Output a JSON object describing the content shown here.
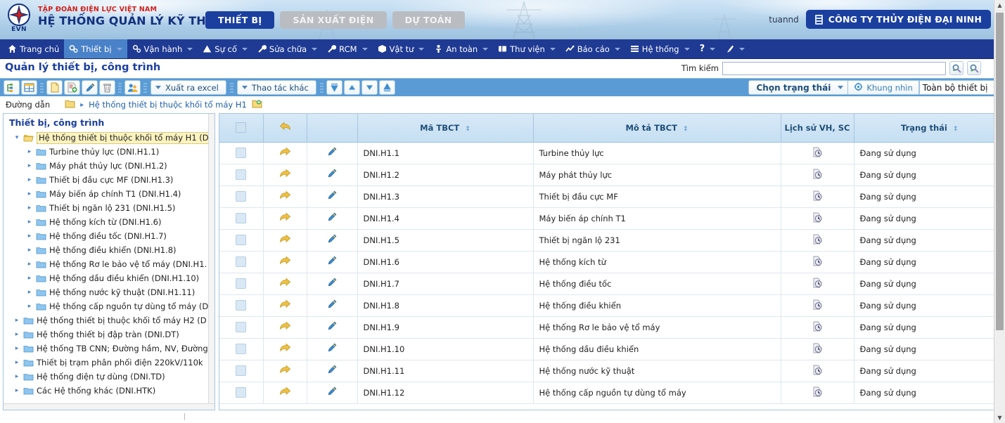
{
  "banner": {
    "logo_text": "EVN",
    "brand_top": "TẬP ĐOÀN ĐIỆN LỰC VIỆT NAM",
    "brand_main": "HỆ THỐNG QUẢN LÝ KỸ THUẬT",
    "app_tabs": [
      {
        "label": "THIẾT BỊ",
        "state": "active"
      },
      {
        "label": "SẢN XUẤT ĐIỆN",
        "state": "idle"
      },
      {
        "label": "DỰ TOÁN",
        "state": "idle"
      }
    ],
    "user_name": "tuannd",
    "company": "CÔNG TY THỦY ĐIỆN ĐẠI NINH"
  },
  "nav": {
    "items": [
      {
        "label": "Trang chủ",
        "icon": "home-icon",
        "caret": false,
        "active": false
      },
      {
        "label": "Thiết bị",
        "icon": "gears-icon",
        "caret": true,
        "active": true
      },
      {
        "label": "Vận hành",
        "icon": "cogs-icon",
        "caret": true,
        "active": false
      },
      {
        "label": "Sự cố",
        "icon": "warning-icon",
        "caret": true,
        "active": false
      },
      {
        "label": "Sửa chữa",
        "icon": "wrench-icon",
        "caret": true,
        "active": false
      },
      {
        "label": "RCM",
        "icon": "wrench-icon",
        "caret": true,
        "active": false
      },
      {
        "label": "Vật tư",
        "icon": "box-icon",
        "caret": true,
        "active": false
      },
      {
        "label": "An toàn",
        "icon": "safety-icon",
        "caret": true,
        "active": false
      },
      {
        "label": "Thư viện",
        "icon": "book-icon",
        "caret": true,
        "active": false
      },
      {
        "label": "Báo cáo",
        "icon": "chart-icon",
        "caret": true,
        "active": false
      },
      {
        "label": "Hệ thống",
        "icon": "list-icon",
        "caret": true,
        "active": false
      },
      {
        "label": "?",
        "icon": "help-icon",
        "caret": true,
        "active": false
      },
      {
        "label": "",
        "icon": "brush-icon",
        "caret": true,
        "active": false
      }
    ]
  },
  "page": {
    "title": "Quản lý thiết bị, công trình"
  },
  "search": {
    "label": "Tìm kiếm",
    "value": "",
    "placeholder": "",
    "buttons": [
      "search-refresh-icon",
      "search-add-icon"
    ]
  },
  "toolbar": {
    "icon_buttons": [
      "tree-view-icon",
      "table-view-icon",
      "new-document-icon",
      "copy-add-icon",
      "edit-pencil-icon",
      "delete-trash-icon",
      "assign-user-icon"
    ],
    "export_excel": "Xuất ra excel",
    "other_actions": "Thao tác khác",
    "move_buttons": [
      "move-top-icon",
      "move-up-icon",
      "move-down-icon",
      "move-bottom-icon"
    ],
    "select_status": "Chọn trạng thái",
    "view_frame": "Khung nhìn",
    "scope_select": "Toàn bộ thiết bị"
  },
  "breadcrumb": {
    "label": "Đường dẫn",
    "path": "Hệ thống thiết bị thuộc khối tổ máy H1"
  },
  "tree": {
    "title": "Thiết bị, công trình",
    "nodes": [
      {
        "label": "Hệ thống thiết bị thuộc khối tổ máy H1 (D",
        "depth": 0,
        "expanded": true,
        "selected": true
      },
      {
        "label": "Turbine thủy lực (DNI.H1.1)",
        "depth": 1,
        "expanded": false,
        "selected": false
      },
      {
        "label": "Máy phát thủy lực (DNI.H1.2)",
        "depth": 1,
        "expanded": false,
        "selected": false
      },
      {
        "label": "Thiết bị đầu cực MF (DNI.H1.3)",
        "depth": 1,
        "expanded": false,
        "selected": false
      },
      {
        "label": "Máy biến áp chính T1 (DNI.H1.4)",
        "depth": 1,
        "expanded": false,
        "selected": false
      },
      {
        "label": "Thiết bị ngăn lộ 231 (DNI.H1.5)",
        "depth": 1,
        "expanded": false,
        "selected": false
      },
      {
        "label": "Hệ thống kích từ (DNI.H1.6)",
        "depth": 1,
        "expanded": false,
        "selected": false
      },
      {
        "label": "Hệ thống điều tốc (DNI.H1.7)",
        "depth": 1,
        "expanded": false,
        "selected": false
      },
      {
        "label": "Hệ thống điều khiển (DNI.H1.8)",
        "depth": 1,
        "expanded": false,
        "selected": false
      },
      {
        "label": "Hệ thống Rơ le bảo vệ tổ máy (DNI.H1.",
        "depth": 1,
        "expanded": false,
        "selected": false
      },
      {
        "label": "Hệ thống dầu điều khiển (DNI.H1.10)",
        "depth": 1,
        "expanded": false,
        "selected": false
      },
      {
        "label": "Hệ thống nước kỹ thuật (DNI.H1.11)",
        "depth": 1,
        "expanded": false,
        "selected": false
      },
      {
        "label": "Hệ thống cấp nguồn tự dùng tổ máy (D",
        "depth": 1,
        "expanded": false,
        "selected": false
      },
      {
        "label": "Hệ thống thiết bị thuộc khối tổ máy H2 (D",
        "depth": 0,
        "expanded": false,
        "selected": false
      },
      {
        "label": "Hệ thống thiết bị đập tràn (DNI.DT)",
        "depth": 0,
        "expanded": false,
        "selected": false
      },
      {
        "label": "Hệ thống TB CNN; Đường hầm, NV, Đường",
        "depth": 0,
        "expanded": false,
        "selected": false
      },
      {
        "label": "Thiết bị trạm phân phối điện 220kV/110k",
        "depth": 0,
        "expanded": false,
        "selected": false
      },
      {
        "label": "Hệ thống điện tự dùng (DNI.TD)",
        "depth": 0,
        "expanded": false,
        "selected": false
      },
      {
        "label": "Các Hệ thống khác (DNI.HTK)",
        "depth": 0,
        "expanded": false,
        "selected": false
      }
    ]
  },
  "grid": {
    "columns": [
      {
        "key": "check",
        "label": "",
        "sortable": false
      },
      {
        "key": "arrow",
        "label": "",
        "sortable": false
      },
      {
        "key": "edit",
        "label": "",
        "sortable": false
      },
      {
        "key": "code",
        "label": "Mã TBCT",
        "sortable": true
      },
      {
        "key": "desc",
        "label": "Mô tả TBCT",
        "sortable": true
      },
      {
        "key": "hist",
        "label": "Lịch sử VH, SC",
        "sortable": false
      },
      {
        "key": "state",
        "label": "Trạng thái",
        "sortable": true
      }
    ],
    "rows": [
      {
        "code": "DNI.H1.1",
        "desc": "Turbine thủy lực",
        "state": "Đang sử dụng"
      },
      {
        "code": "DNI.H1.2",
        "desc": "Máy phát thủy lực",
        "state": "Đang sử dụng"
      },
      {
        "code": "DNI.H1.3",
        "desc": "Thiết bị đầu cực MF",
        "state": "Đang sử dụng"
      },
      {
        "code": "DNI.H1.4",
        "desc": "Máy biến áp chính T1",
        "state": "Đang sử dụng"
      },
      {
        "code": "DNI.H1.5",
        "desc": "Thiết bị ngăn lộ 231",
        "state": "Đang sử dụng"
      },
      {
        "code": "DNI.H1.6",
        "desc": "Hệ thống kích từ",
        "state": "Đang sử dụng"
      },
      {
        "code": "DNI.H1.7",
        "desc": "Hệ thống điều tốc",
        "state": "Đang sử dụng"
      },
      {
        "code": "DNI.H1.8",
        "desc": "Hệ thống điều khiển",
        "state": "Đang sử dụng"
      },
      {
        "code": "DNI.H1.9",
        "desc": "Hệ thống Rơ le bảo vệ tổ máy",
        "state": "Đang sử dụng"
      },
      {
        "code": "DNI.H1.10",
        "desc": "Hệ thống dầu điều khiển",
        "state": "Đang sử dụng"
      },
      {
        "code": "DNI.H1.11",
        "desc": "Hệ thống nước kỹ thuật",
        "state": "Đang sử dụng"
      },
      {
        "code": "DNI.H1.12",
        "desc": "Hệ thống cấp nguồn tự dùng tổ máy",
        "state": "Đang sử dụng"
      }
    ]
  },
  "colors": {
    "brand_blue": "#1b3f9e",
    "nav_blue": "#1f3a93",
    "toolbar_blue": "#5a9bd5",
    "brand_red": "#d3201a",
    "header_cell": "#c5dff2",
    "selected_node": "#fdf3c0"
  }
}
